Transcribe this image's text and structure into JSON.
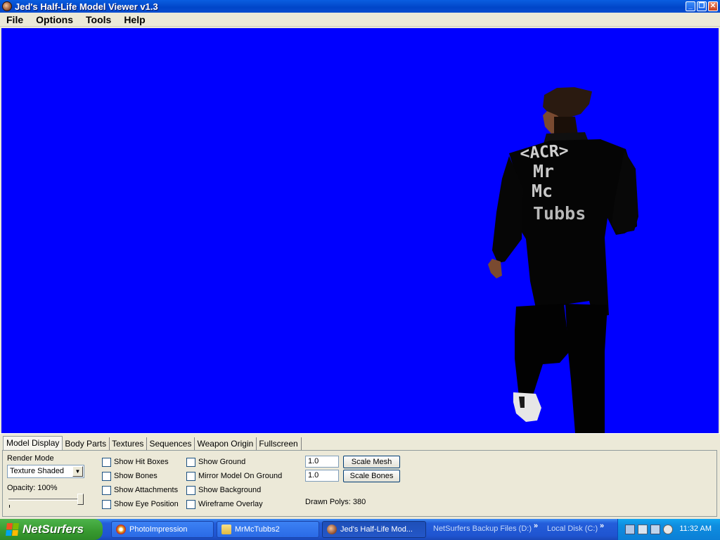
{
  "window": {
    "title": "Jed's Half-Life Model Viewer v1.3",
    "controls": {
      "minimize": "_",
      "maximize": "❐",
      "close": "✕"
    }
  },
  "menu": [
    "File",
    "Options",
    "Tools",
    "Help"
  ],
  "viewport": {
    "background_color": "#0000ff",
    "model_text": [
      "<ACR>",
      "Mr",
      "Mc",
      "Tubbs"
    ]
  },
  "tabs": [
    "Model Display",
    "Body Parts",
    "Textures",
    "Sequences",
    "Weapon Origin",
    "Fullscreen"
  ],
  "model_display": {
    "render_mode_label": "Render Mode",
    "render_mode_value": "Texture Shaded",
    "opacity_label": "Opacity: 100%",
    "opacity_value": 1.0,
    "checkboxes_col1": [
      "Show Hit Boxes",
      "Show Bones",
      "Show Attachments",
      "Show Eye Position"
    ],
    "checkboxes_col2": [
      "Show Ground",
      "Mirror Model On Ground",
      "Show Background",
      "Wireframe Overlay"
    ],
    "scale_mesh_value": "1.0",
    "scale_mesh_button": "Scale Mesh",
    "scale_bones_value": "1.0",
    "scale_bones_button": "Scale Bones",
    "drawn_polys": "Drawn Polys: 380"
  },
  "taskbar": {
    "start_label": "NetSurfers",
    "tasks": [
      "PhotoImpression",
      "MrMcTubbs2",
      "Jed's Half-Life Mod..."
    ],
    "toolbars": [
      "NetSurfers Backup Files (D:)",
      "Local Disk (C:)"
    ],
    "toolbar_chevron": "»",
    "clock": "11:32 AM"
  }
}
